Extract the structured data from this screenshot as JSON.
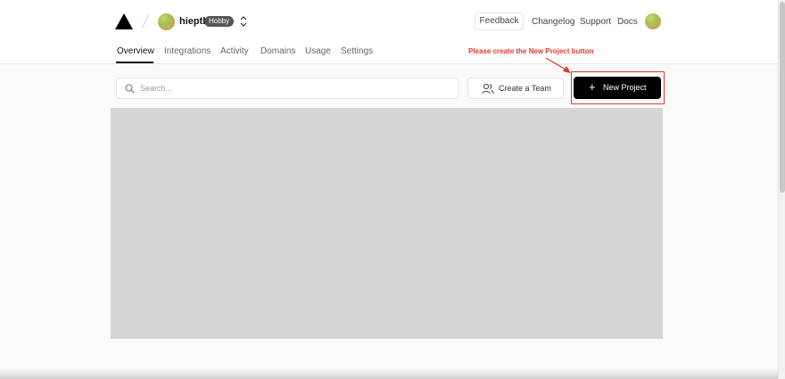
{
  "header": {
    "logo_icon": "triangle-logo-icon",
    "team": {
      "name": "hieptl",
      "plan_badge": "Hobby",
      "avatar_icon": "avatar"
    },
    "switcher_icon": "chevron-up-down-icon",
    "feedback_label": "Feedback",
    "links": [
      "Changelog",
      "Support",
      "Docs"
    ],
    "user_avatar_icon": "avatar"
  },
  "tabs": [
    {
      "label": "Overview",
      "active": true
    },
    {
      "label": "Integrations",
      "active": false
    },
    {
      "label": "Activity",
      "active": false
    },
    {
      "label": "Domains",
      "active": false
    },
    {
      "label": "Usage",
      "active": false
    },
    {
      "label": "Settings",
      "active": false
    }
  ],
  "annotation": {
    "text": "Please create the New Project button",
    "color": "#e03a2a"
  },
  "toolbar": {
    "search_placeholder": "Search...",
    "search_icon": "search-icon",
    "create_team_label": "Create a Team",
    "create_team_icon": "users-icon",
    "new_project_label": "New Project",
    "new_project_icon": "plus-icon"
  },
  "colors": {
    "accent": "#000000",
    "annotation": "#e03a2a",
    "placeholder_area": "#d6d6d6",
    "background": "#fafafa"
  }
}
